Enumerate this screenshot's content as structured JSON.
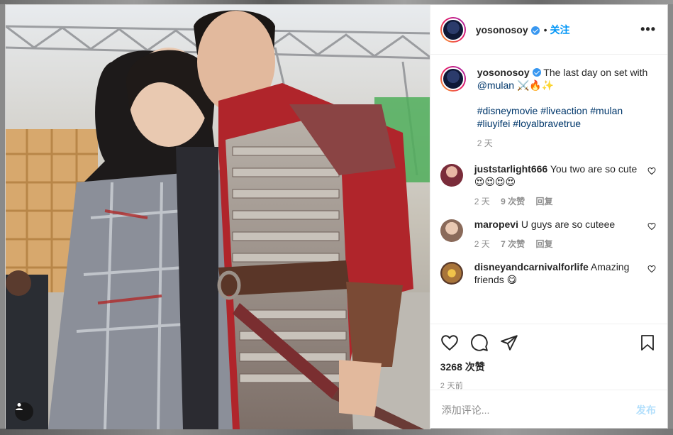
{
  "post": {
    "author": "yosonosoy",
    "follow_label": "关注",
    "dot": "•",
    "more_label": "•••"
  },
  "caption": {
    "author": "yosonosoy",
    "text": "The last day on set with",
    "mention": "@mulan",
    "emoji": "⚔️🔥✨",
    "hashtags": "#disneymovie #liveaction #mulan #liuyifei #loyalbravetrue",
    "time": "2 天"
  },
  "comments": [
    {
      "user": "juststarlight666",
      "text": "You two are so cute",
      "emoji": "😍😍😍😍",
      "time": "2 天",
      "likes": "9 次赞",
      "reply": "回复",
      "avatar_color": "#7a2c3a"
    },
    {
      "user": "maropevi",
      "text": "U guys are so cuteee",
      "emoji": "",
      "time": "2 天",
      "likes": "7 次赞",
      "reply": "回复",
      "avatar_color": "#c9a38a"
    },
    {
      "user": "disneyandcarnivalforlife",
      "text": "Amazing friends",
      "emoji": "😋",
      "time": "",
      "likes": "",
      "reply": "",
      "avatar_color": "#a8743a"
    }
  ],
  "stats": {
    "likes": "3268 次赞",
    "posted": "2 天前"
  },
  "composer": {
    "placeholder": "添加评论...",
    "post_label": "发布"
  },
  "colors": {
    "accent": "#0095f6",
    "mention": "#00376b",
    "muted": "#8e8e8e"
  },
  "icons": [
    "heart-icon",
    "comment-icon",
    "share-icon",
    "bookmark-icon",
    "user-tag-icon",
    "more-icon",
    "verified-icon"
  ]
}
